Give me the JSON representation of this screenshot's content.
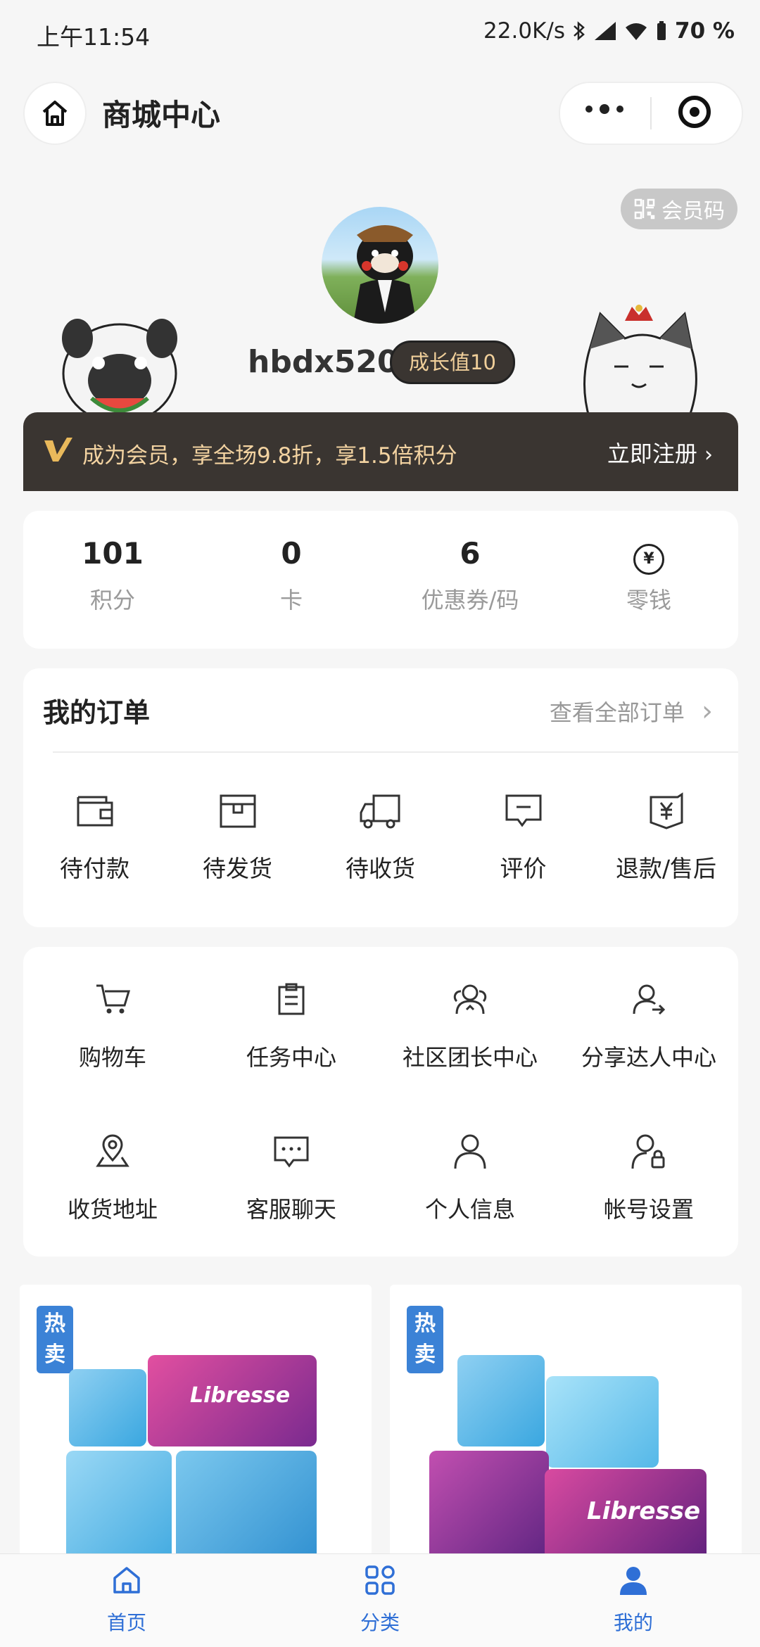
{
  "status_bar": {
    "time": "上午11:54",
    "speed": "22.0K/s",
    "battery": "70 %"
  },
  "nav": {
    "title": "商城中心"
  },
  "profile": {
    "member_code": "会员码",
    "username": "hbdx520",
    "growth_badge": "成长值10",
    "vip_text": "成为会员，享全场9.8折，享1.5倍积分",
    "register": "立即注册"
  },
  "stats": [
    {
      "value": "101",
      "label": "积分"
    },
    {
      "value": "0",
      "label": "卡"
    },
    {
      "value": "6",
      "label": "优惠券/码"
    },
    {
      "value": "",
      "label": "零钱"
    }
  ],
  "orders": {
    "heading": "我的订单",
    "view_all": "查看全部订单",
    "items": [
      {
        "label": "待付款",
        "icon": "wallet-icon"
      },
      {
        "label": "待发货",
        "icon": "box-icon"
      },
      {
        "label": "待收货",
        "icon": "truck-icon"
      },
      {
        "label": "评价",
        "icon": "comment-icon"
      },
      {
        "label": "退款/售后",
        "icon": "refund-icon"
      }
    ]
  },
  "menu": [
    {
      "label": "购物车",
      "icon": "cart-icon"
    },
    {
      "label": "任务中心",
      "icon": "clipboard-icon"
    },
    {
      "label": "社区团长中心",
      "icon": "community-leader-icon"
    },
    {
      "label": "分享达人中心",
      "icon": "share-person-icon"
    },
    {
      "label": "收货地址",
      "icon": "location-icon"
    },
    {
      "label": "客服聊天",
      "icon": "chat-icon"
    },
    {
      "label": "个人信息",
      "icon": "user-icon"
    },
    {
      "label": "帐号设置",
      "icon": "user-lock-icon"
    }
  ],
  "products": [
    {
      "badge": "热卖",
      "brand": "Libresse"
    },
    {
      "badge": "热卖",
      "brand": "Libresse"
    }
  ],
  "tabs": [
    {
      "label": "首页",
      "color": "#2f6fd6"
    },
    {
      "label": "分类",
      "color": "#2f6fd6"
    },
    {
      "label": "我的",
      "color": "#2f6fd6"
    }
  ]
}
